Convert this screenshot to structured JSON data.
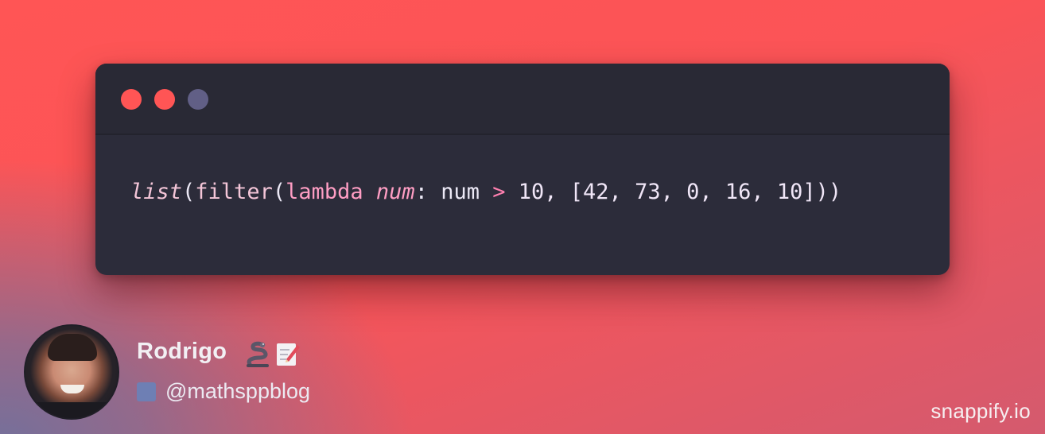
{
  "code_window": {
    "controls": [
      "close",
      "minimize",
      "maximize"
    ],
    "code_tokens": [
      {
        "text": "list",
        "kind": "fn-italic"
      },
      {
        "text": "(",
        "kind": "plain"
      },
      {
        "text": "filter",
        "kind": "fn"
      },
      {
        "text": "(",
        "kind": "plain"
      },
      {
        "text": "lambda",
        "kind": "kw"
      },
      {
        "text": " ",
        "kind": "plain"
      },
      {
        "text": "num",
        "kind": "param"
      },
      {
        "text": ": num ",
        "kind": "plain"
      },
      {
        "text": ">",
        "kind": "op"
      },
      {
        "text": " 10, [42, 73, 0, 16, 10]))",
        "kind": "num"
      }
    ]
  },
  "author": {
    "name": "Rodrigo",
    "emoji_1": "snake-emoji",
    "emoji_2": "memo-emoji",
    "handle": "@mathsppblog",
    "handle_icon": "twitter-icon"
  },
  "brand": {
    "text": "snappify.io"
  },
  "colors": {
    "background_primary": "#ff5555",
    "background_secondary": "#74709b",
    "window_bg": "#2c2c3a",
    "titlebar_bg": "#292935",
    "dot_red": "#ff5555",
    "dot_purple": "#615f86",
    "keyword_pink": "#ff9ec4"
  }
}
